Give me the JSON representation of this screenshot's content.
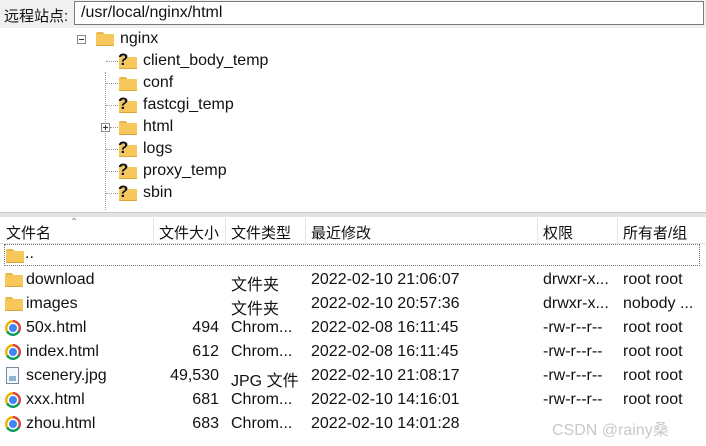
{
  "pathbar": {
    "label": "远程站点:",
    "value": "/usr/local/nginx/html"
  },
  "tree": {
    "root": "nginx",
    "children": [
      {
        "label": "client_body_temp",
        "icon": "unknown-folder-icon"
      },
      {
        "label": "conf",
        "icon": "folder-icon"
      },
      {
        "label": "fastcgi_temp",
        "icon": "unknown-folder-icon"
      },
      {
        "label": "html",
        "icon": "folder-icon",
        "expandable": true
      },
      {
        "label": "logs",
        "icon": "unknown-folder-icon"
      },
      {
        "label": "proxy_temp",
        "icon": "unknown-folder-icon"
      },
      {
        "label": "sbin",
        "icon": "unknown-folder-icon"
      }
    ]
  },
  "columns": {
    "name": "文件名",
    "size": "文件大小",
    "type": "文件类型",
    "modified": "最近修改",
    "perms": "权限",
    "owner": "所有者/组"
  },
  "parent_row": "..",
  "files": [
    {
      "name": "download",
      "icon": "folder-icon",
      "size": "",
      "type": "文件夹",
      "modified": "2022-02-10 21:06:07",
      "perms": "drwxr-x...",
      "owner": "root root"
    },
    {
      "name": "images",
      "icon": "folder-icon",
      "size": "",
      "type": "文件夹",
      "modified": "2022-02-10 20:57:36",
      "perms": "drwxr-x...",
      "owner": "nobody ..."
    },
    {
      "name": "50x.html",
      "icon": "chrome-icon",
      "size": "494",
      "type": "Chrom...",
      "modified": "2022-02-08 16:11:45",
      "perms": "-rw-r--r--",
      "owner": "root root"
    },
    {
      "name": "index.html",
      "icon": "chrome-icon",
      "size": "612",
      "type": "Chrom...",
      "modified": "2022-02-08 16:11:45",
      "perms": "-rw-r--r--",
      "owner": "root root"
    },
    {
      "name": "scenery.jpg",
      "icon": "jpg-file-icon",
      "size": "49,530",
      "type": "JPG 文件",
      "modified": "2022-02-10 21:08:17",
      "perms": "-rw-r--r--",
      "owner": "root root"
    },
    {
      "name": "xxx.html",
      "icon": "chrome-icon",
      "size": "681",
      "type": "Chrom...",
      "modified": "2022-02-10 14:16:01",
      "perms": "-rw-r--r--",
      "owner": "root root"
    },
    {
      "name": "zhou.html",
      "icon": "chrome-icon",
      "size": "683",
      "type": "Chrom...",
      "modified": "2022-02-10 14:01:28",
      "perms": "-rw-r--r--",
      "owner": "root root"
    }
  ],
  "watermark": "CSDN @rainy桑"
}
